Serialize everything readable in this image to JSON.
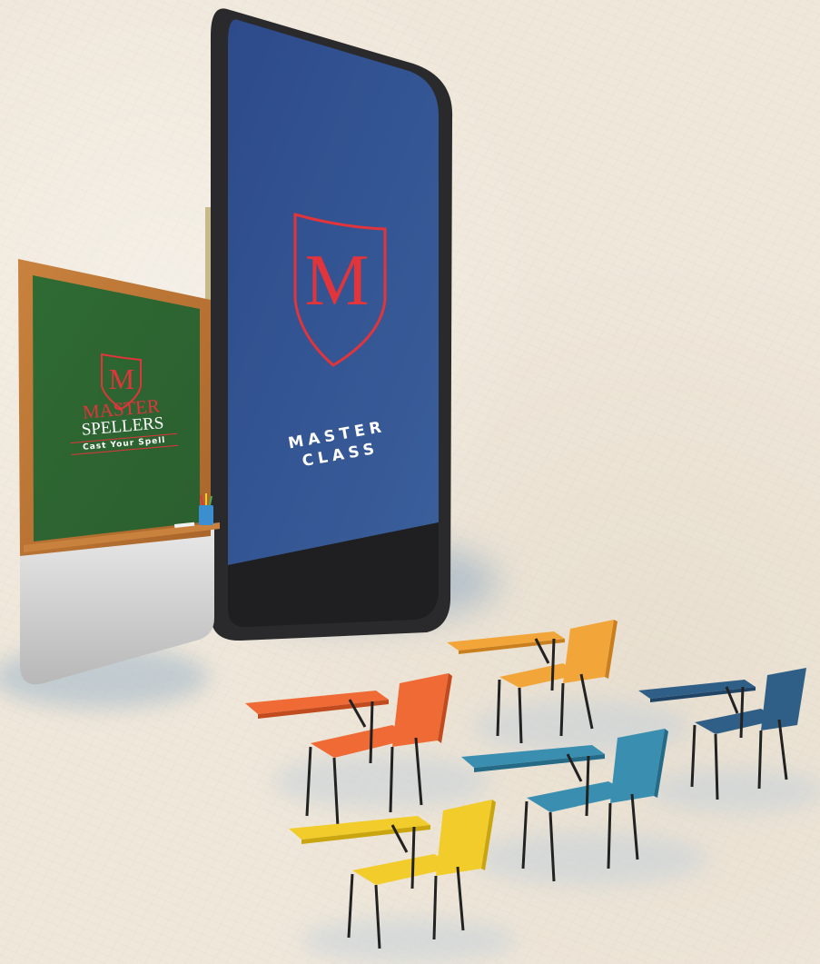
{
  "phone_screen": {
    "logo_letter": "M",
    "title_line1": "MASTER",
    "title_line2": "CLASS"
  },
  "chalkboard": {
    "logo_letter": "M",
    "brand_line1": "MASTER",
    "brand_line2": "SPELLERS",
    "tagline": "Cast Your Spell"
  },
  "colors": {
    "phone_screen": "#2f4f8f",
    "accent_red": "#e2343b",
    "chalkboard_green": "#2f6a33",
    "chair_orange": "#f06a35",
    "chair_amber": "#f2a63a",
    "chair_blue": "#3a8fb0",
    "chair_navy": "#2f5f86",
    "chair_yellow": "#f2cc2a"
  }
}
